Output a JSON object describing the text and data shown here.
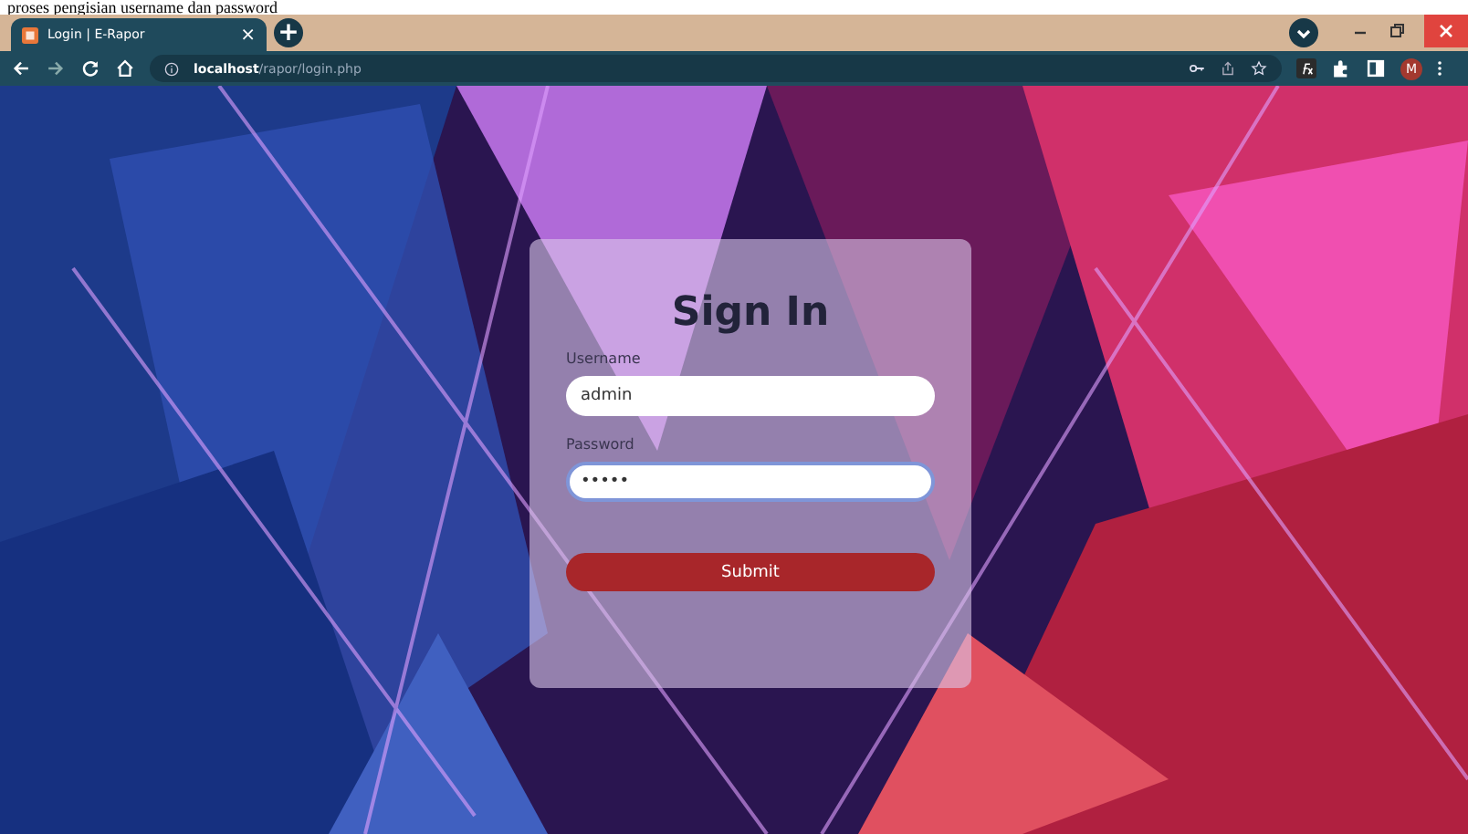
{
  "caption": "proses pengisian username dan password",
  "browser": {
    "tab_title": "Login | E-Rapor",
    "tab_close": "×",
    "new_tab": "+",
    "url_host": "localhost",
    "url_path": "/rapor/login.php",
    "profile_initial": "M"
  },
  "form": {
    "title": "Sign In",
    "fields": [
      {
        "label": "Username",
        "value": "admin",
        "focused": false
      },
      {
        "label": "Password",
        "value": "•••••",
        "focused": true
      }
    ],
    "submit": "Submit"
  }
}
